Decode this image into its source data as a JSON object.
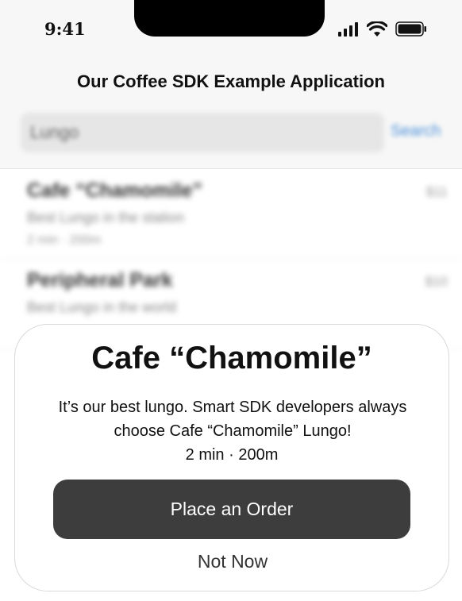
{
  "status_bar": {
    "time": "9:41",
    "icons": [
      "cellular-signal-icon",
      "wifi-icon",
      "battery-icon"
    ]
  },
  "header": {
    "title": "Our Coffee SDK Example Application"
  },
  "search": {
    "value": "Lungo",
    "button_label": "Search"
  },
  "list": {
    "items": [
      {
        "title": "Cafe “Chamomile”",
        "description": "Best Lungo in the station",
        "meta": "2 min · 200m",
        "price": "$11"
      },
      {
        "title": "Peripheral Park",
        "description": "Best Lungo in the world",
        "meta": "",
        "price": "$10"
      }
    ]
  },
  "popup": {
    "title": "Cafe “Chamomile”",
    "description": "It’s our best lungo. Smart SDK developers always choose Cafe “Chamomile” Lungo!",
    "meta": "2 min · 200m",
    "primary_button": "Place an Order",
    "secondary_button": "Not Now"
  },
  "colors": {
    "background": "#ffffff",
    "header_background": "#f7f7f7",
    "button_background": "#3d3d3d",
    "link_blue": "#4a90d9"
  }
}
